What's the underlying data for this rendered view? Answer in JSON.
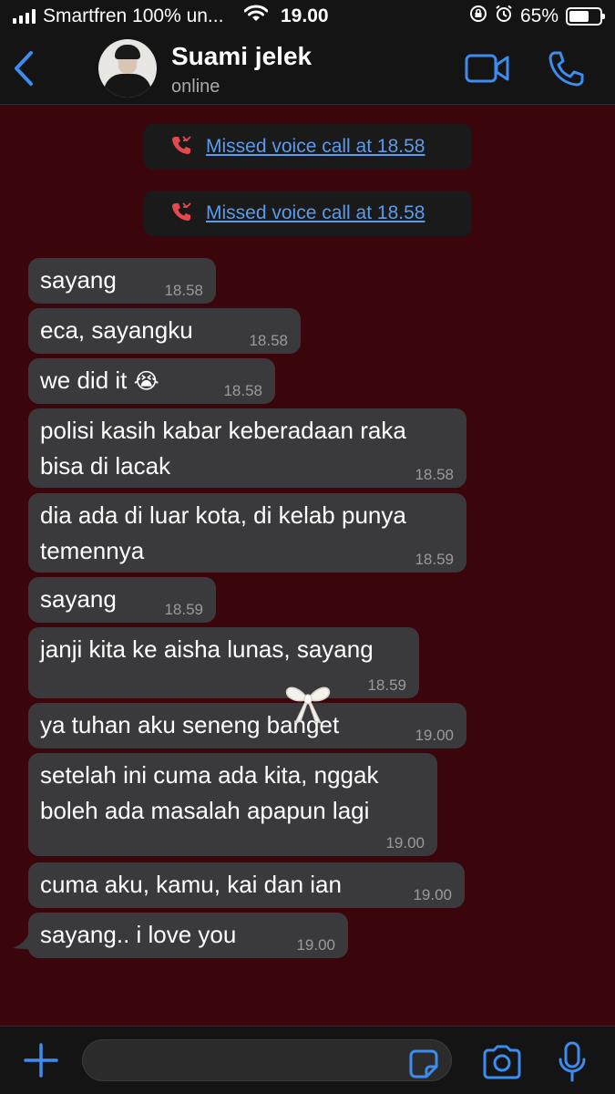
{
  "status_bar": {
    "carrier": "Smartfren 100% un...",
    "time": "19.00",
    "battery": "65%",
    "battery_level": 0.65
  },
  "header": {
    "contact_name": "Suami jelek",
    "contact_status": "online",
    "back_icon": "chevron-left-icon",
    "video_icon": "video-camera-icon",
    "call_icon": "phone-icon"
  },
  "colors": {
    "background": "#3a060c",
    "bubble": "#3a3a3c",
    "link": "#5b9bea",
    "missed_call": "#e5484d",
    "accent": "#3d8cf0"
  },
  "system_messages": [
    {
      "text": "Missed voice call at 18.58",
      "icon": "missed-call-icon"
    },
    {
      "text": "Missed voice call at 18.58",
      "icon": "missed-call-icon"
    }
  ],
  "messages": [
    {
      "text": "sayang",
      "time": "18.58"
    },
    {
      "text": "eca, sayangku",
      "time": "18.58"
    },
    {
      "text": "we did it",
      "emoji": "😭",
      "time": "18.58"
    },
    {
      "text": "polisi kasih kabar keberadaan raka bisa di lacak",
      "time": "18.58"
    },
    {
      "text": "dia ada di luar kota, di kelab punya temennya",
      "time": "18.59"
    },
    {
      "text": "sayang",
      "time": "18.59"
    },
    {
      "text": "janji kita ke aisha lunas, sayang",
      "time": "18.59"
    },
    {
      "text": "ya tuhan aku seneng banget",
      "time": "19.00"
    },
    {
      "text": "setelah ini cuma ada kita, nggak boleh ada masalah apapun lagi",
      "time": "19.00"
    },
    {
      "text": "cuma aku, kamu, kai dan ian",
      "time": "19.00"
    },
    {
      "text": "sayang.. i love you",
      "time": "19.00"
    }
  ],
  "decoration": {
    "sticker": "bow-icon"
  },
  "input_bar": {
    "value": "",
    "icons": [
      "plus-icon",
      "sticker-icon",
      "camera-icon",
      "microphone-icon"
    ]
  }
}
